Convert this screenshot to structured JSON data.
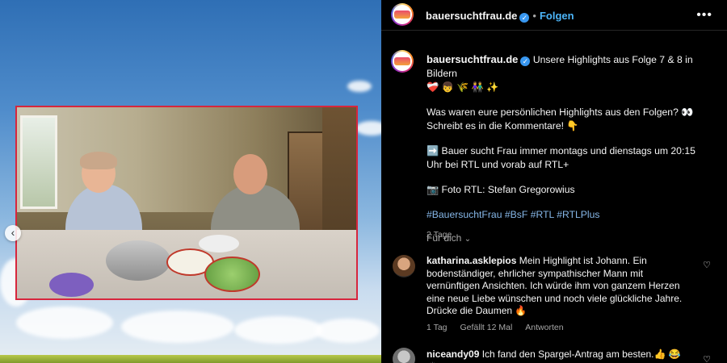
{
  "post": {
    "account": "bauersuchtfrau.de",
    "follow_label": "Folgen",
    "separator": "•",
    "more_icon": "more-icon",
    "caption_title": "Unsere Highlights aus Folge 7 & 8 in Bildern",
    "caption_emojis": "❤️‍🩹 👦 🌾 👫 ✨",
    "caption_line2": "Was waren eure persönlichen Highlights aus den Folgen? 👀 Schreibt es in die Kommentare! 👇",
    "caption_line3": "➡️ Bauer sucht Frau immer montags und dienstags um 20:15 Uhr bei RTL und vorab auf RTL+",
    "caption_line4": "📷 Foto RTL: Stefan Gregorowius",
    "hashtags": "#BauersuchtFrau #BsF #RTL #RTLPlus",
    "age": "2 Tage",
    "sort_label": "Für dich",
    "sort_icon": "chevron-down-icon"
  },
  "comments": [
    {
      "user": "katharina.asklepios",
      "text": "Mein Highlight ist Johann. Ein bodenständiger, ehrlicher sympathischer Mann mit vernünftigen Ansichten. Ich würde ihm von ganzem Herzen eine neue Liebe wünschen und noch viele glückliche Jahre. Drücke die Daumen 🔥",
      "age": "1 Tag",
      "likes": "Gefällt 12 Mal",
      "reply_label": "Antworten"
    },
    {
      "user": "niceandy09",
      "text": "Ich fand den Spargel-Antrag am besten.👍 😂 🙌",
      "age": "",
      "likes": "",
      "reply_label": ""
    }
  ],
  "colors": {
    "accent": "#4cb5f9",
    "hashtag": "#86b7e8",
    "verified": "#3897f0",
    "photo_border": "#d7263d"
  },
  "media": {
    "prev_icon": "chevron-left-icon"
  }
}
